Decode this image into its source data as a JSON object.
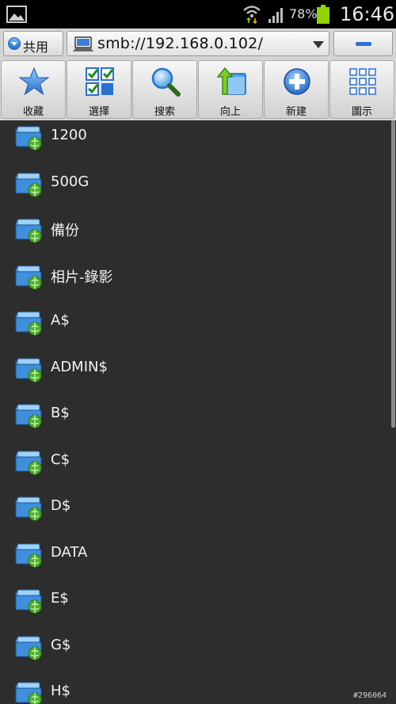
{
  "status_bar": {
    "battery": "78%",
    "time": "16:46",
    "icons": [
      "gallery-icon",
      "wifi-icon",
      "signal-icon",
      "battery-icon"
    ]
  },
  "address_bar": {
    "share_label": "共用",
    "path": "smb://192.168.0.102/"
  },
  "toolbar": {
    "items": [
      {
        "label": "收藏",
        "icon": "star-icon"
      },
      {
        "label": "選擇",
        "icon": "checkbox-grid-icon"
      },
      {
        "label": "搜索",
        "icon": "magnifier-icon"
      },
      {
        "label": "向上",
        "icon": "folder-up-icon"
      },
      {
        "label": "新建",
        "icon": "add-icon"
      },
      {
        "label": "圖示",
        "icon": "grid-view-icon"
      }
    ]
  },
  "files": [
    {
      "name": "1200"
    },
    {
      "name": "500G"
    },
    {
      "name": "備份"
    },
    {
      "name": "相片-錄影"
    },
    {
      "name": "A$"
    },
    {
      "name": "ADMIN$"
    },
    {
      "name": "B$"
    },
    {
      "name": "C$"
    },
    {
      "name": "D$"
    },
    {
      "name": "DATA"
    },
    {
      "name": "E$"
    },
    {
      "name": "G$"
    },
    {
      "name": "H$"
    }
  ],
  "watermark": "#296064",
  "colors": {
    "list_background": "#2d2d2d",
    "toolbar_background": "#d6d6d6",
    "accent_blue": "#2d6ed8",
    "battery_green": "#8fd400"
  }
}
